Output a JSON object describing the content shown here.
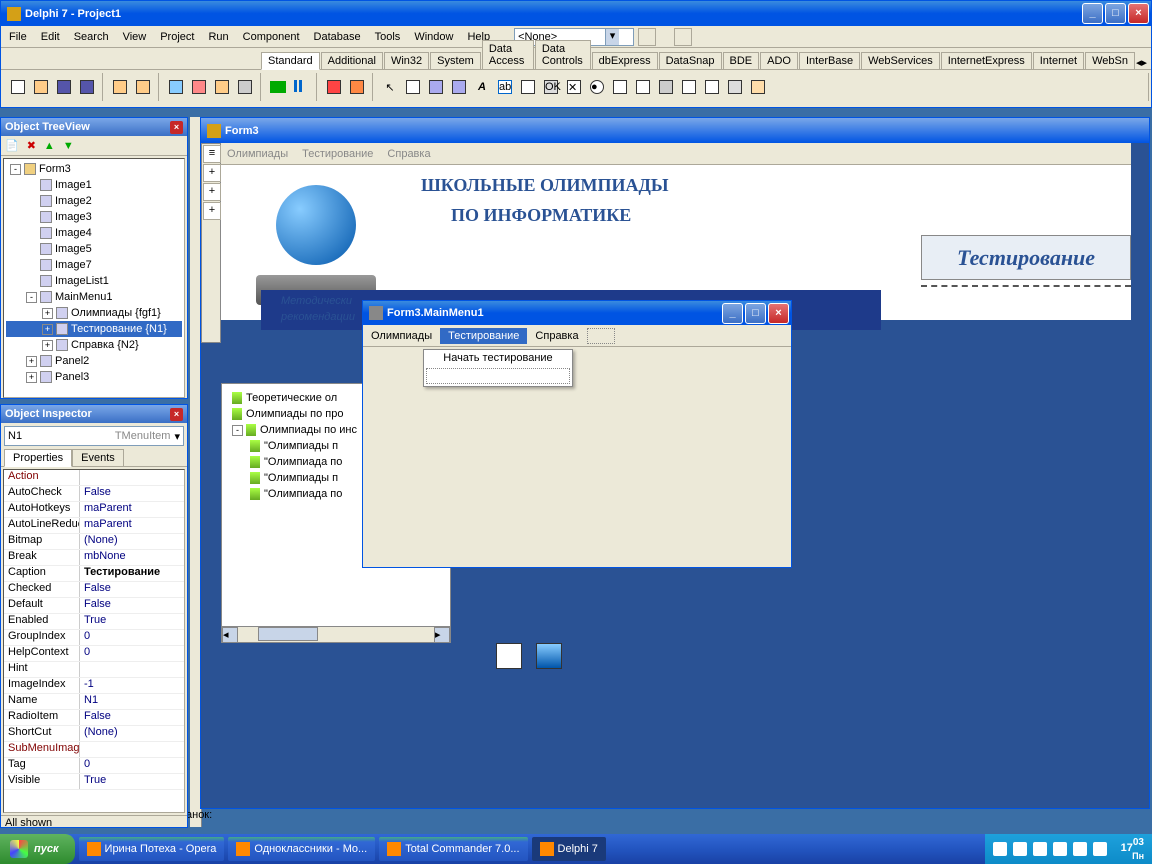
{
  "main_window": {
    "title": "Delphi 7 - Project1",
    "menus": [
      "File",
      "Edit",
      "Search",
      "View",
      "Project",
      "Run",
      "Component",
      "Database",
      "Tools",
      "Window",
      "Help"
    ],
    "combo_value": "<None>",
    "tabs": [
      "Standard",
      "Additional",
      "Win32",
      "System",
      "Data Access",
      "Data Controls",
      "dbExpress",
      "DataSnap",
      "BDE",
      "ADO",
      "InterBase",
      "WebServices",
      "InternetExpress",
      "Internet",
      "WebSn"
    ]
  },
  "object_tree": {
    "title": "Object TreeView",
    "items": [
      {
        "indent": 0,
        "toggle": "-",
        "label": "Form3"
      },
      {
        "indent": 1,
        "toggle": "",
        "label": "Image1",
        "ico": "comp"
      },
      {
        "indent": 1,
        "toggle": "",
        "label": "Image2",
        "ico": "comp"
      },
      {
        "indent": 1,
        "toggle": "",
        "label": "Image3",
        "ico": "comp"
      },
      {
        "indent": 1,
        "toggle": "",
        "label": "Image4",
        "ico": "comp"
      },
      {
        "indent": 1,
        "toggle": "",
        "label": "Image5",
        "ico": "comp"
      },
      {
        "indent": 1,
        "toggle": "",
        "label": "Image7",
        "ico": "comp"
      },
      {
        "indent": 1,
        "toggle": "",
        "label": "ImageList1",
        "ico": "comp"
      },
      {
        "indent": 1,
        "toggle": "-",
        "label": "MainMenu1",
        "ico": "comp"
      },
      {
        "indent": 2,
        "toggle": "+",
        "label": "Олимпиады {fgf1}",
        "ico": "comp"
      },
      {
        "indent": 2,
        "toggle": "+",
        "label": "Тестирование {N1}",
        "ico": "comp",
        "sel": true
      },
      {
        "indent": 2,
        "toggle": "+",
        "label": "Справка {N2}",
        "ico": "comp"
      },
      {
        "indent": 1,
        "toggle": "+",
        "label": "Panel2",
        "ico": "comp"
      },
      {
        "indent": 1,
        "toggle": "+",
        "label": "Panel3",
        "ico": "comp"
      }
    ]
  },
  "object_inspector": {
    "title": "Object Inspector",
    "selected_name": "N1",
    "selected_type": "TMenuItem",
    "tabs": [
      "Properties",
      "Events"
    ],
    "props": [
      {
        "name": "Action",
        "val": "",
        "red": true
      },
      {
        "name": "AutoCheck",
        "val": "False"
      },
      {
        "name": "AutoHotkeys",
        "val": "maParent"
      },
      {
        "name": "AutoLineReduc",
        "val": "maParent"
      },
      {
        "name": "Bitmap",
        "val": "(None)"
      },
      {
        "name": "Break",
        "val": "mbNone"
      },
      {
        "name": "Caption",
        "val": "Тестирование",
        "bold": true
      },
      {
        "name": "Checked",
        "val": "False"
      },
      {
        "name": "Default",
        "val": "False"
      },
      {
        "name": "Enabled",
        "val": "True"
      },
      {
        "name": "GroupIndex",
        "val": "0"
      },
      {
        "name": "HelpContext",
        "val": "0"
      },
      {
        "name": "Hint",
        "val": ""
      },
      {
        "name": "ImageIndex",
        "val": "-1"
      },
      {
        "name": "Name",
        "val": "N1"
      },
      {
        "name": "RadioItem",
        "val": "False"
      },
      {
        "name": "ShortCut",
        "val": "(None)"
      },
      {
        "name": "SubMenuImage",
        "val": "",
        "red": true
      },
      {
        "name": "Tag",
        "val": "0"
      },
      {
        "name": "Visible",
        "val": "True"
      }
    ],
    "status": "All shown"
  },
  "form3": {
    "title": "Form3",
    "menus": [
      "Олимпиады",
      "Тестирование",
      "Справка"
    ],
    "headline1": "ШКОЛЬНЫЕ ОЛИМПИАДЫ",
    "headline2": "ПО ИНФОРМАТИКЕ",
    "test_button": "Тестирование",
    "method_line1": "Методически",
    "method_line2": "рекомендации",
    "secondary_tree": [
      {
        "indent": 0,
        "toggle": "",
        "label": "Теоретические ол"
      },
      {
        "indent": 0,
        "toggle": "",
        "label": "Олимпиады по про"
      },
      {
        "indent": 0,
        "toggle": "-",
        "label": "Олимпиады по инс"
      },
      {
        "indent": 1,
        "toggle": "",
        "label": "\"Олимпиады п"
      },
      {
        "indent": 1,
        "toggle": "",
        "label": "\"Олимпиада по"
      },
      {
        "indent": 1,
        "toggle": "",
        "label": "\"Олимпиады п"
      },
      {
        "indent": 1,
        "toggle": "",
        "label": "\"Олимпиада по"
      }
    ],
    "left_strip_label": "анок:"
  },
  "menu_editor": {
    "title": "Form3.MainMenu1",
    "top_items": [
      "Олимпиады",
      "Тестирование",
      "Справка"
    ],
    "dropdown_item": "Начать тестирование"
  },
  "taskbar": {
    "start": "пуск",
    "items": [
      {
        "label": "Ирина Потеха - Opera",
        "active": false
      },
      {
        "label": "Одноклассники - Mo...",
        "active": false
      },
      {
        "label": "Total Commander 7.0...",
        "active": false
      },
      {
        "label": "Delphi 7",
        "active": true
      }
    ],
    "clock_time": "17",
    "clock_min": "03",
    "clock_suffix": "Пн"
  }
}
